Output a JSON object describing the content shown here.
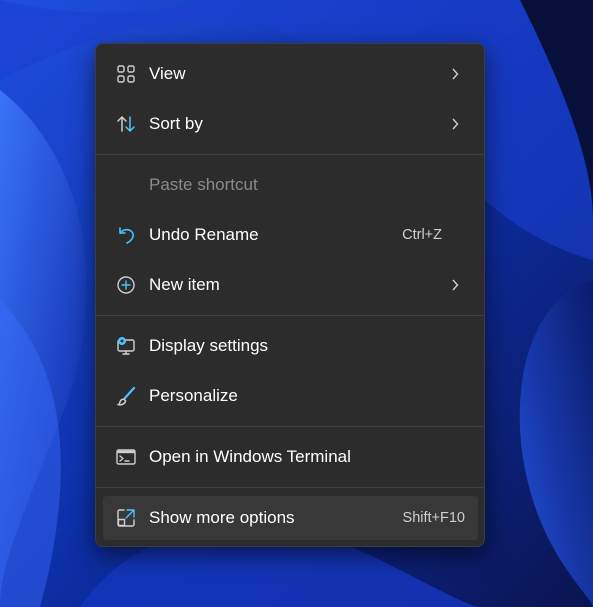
{
  "context_menu": {
    "items": [
      {
        "label": "View",
        "icon": "grid-icon",
        "submenu": true
      },
      {
        "label": "Sort by",
        "icon": "sort-arrows-icon",
        "submenu": true
      },
      {
        "label": "Paste shortcut",
        "disabled": true
      },
      {
        "label": "Undo Rename",
        "icon": "undo-icon",
        "shortcut": "Ctrl+Z"
      },
      {
        "label": "New item",
        "icon": "plus-circle-icon",
        "submenu": true
      },
      {
        "label": "Display settings",
        "icon": "display-gear-icon"
      },
      {
        "label": "Personalize",
        "icon": "brush-icon"
      },
      {
        "label": "Open in Windows Terminal",
        "icon": "terminal-icon"
      },
      {
        "label": "Show more options",
        "icon": "expand-icon",
        "shortcut": "Shift+F10",
        "highlighted": true
      }
    ]
  },
  "colors": {
    "menu_background": "#2c2c2c",
    "icon_accent": "#4cc2ff",
    "text": "#ffffff",
    "disabled_text": "#8a8a8a"
  }
}
